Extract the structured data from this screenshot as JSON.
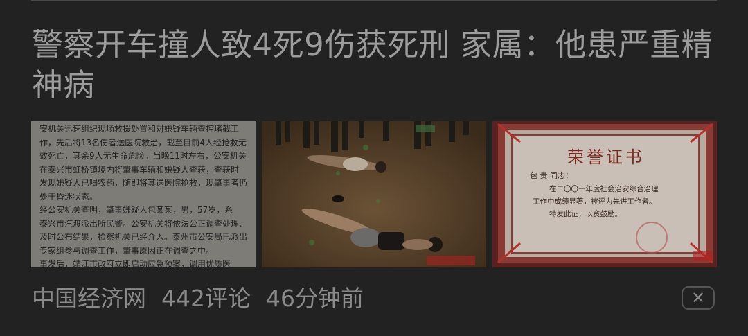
{
  "article": {
    "headline": "警察开车撞人致4死9伤获死刑 家属：他患严重精神病",
    "source": "中国经济网",
    "comments": "442评论",
    "time": "46分钟前",
    "dismiss_glyph": "✕"
  },
  "thumbnails": {
    "doc_text": "安机关迅速组织现场救援处置和对嫌疑车辆查控堵截工\n作，先后将13名伤者送医院救治，截至目前4人经抢救无\n效死亡，其余9人无生命危险。当晚11时左右，公安机关\n在泰兴市虹桥镇境内将肇事车辆和嫌疑人查获，查获时\n发现嫌疑人已喝农药，随即将其送医院抢救，现肇事者仍\n处于昏迷状态。\n    经公安机关查明，肇事嫌疑人包某某，男，57岁，系\n泰兴市汽渡派出所民警。公安机关将依法公正调查处理、\n及时公布结果，检察机关已经介入。泰州市公安局已派出\n专家组参与调查工作，肇事原因正在调查之中。\n    事发后，靖江市政府立即启动应急预案，调用优质医",
    "cert_title": "荣誉证书",
    "cert_name": "包 贵 同志：",
    "cert_line1": "在二〇〇一年度社会治安综合治理",
    "cert_line2": "工作中成绩显著，被评为先进工作者。",
    "cert_line3": "特发此证，以资鼓励。"
  },
  "colors": {
    "background": "#222222",
    "headline": "#9c9c9c",
    "meta": "#8a8a8a"
  }
}
